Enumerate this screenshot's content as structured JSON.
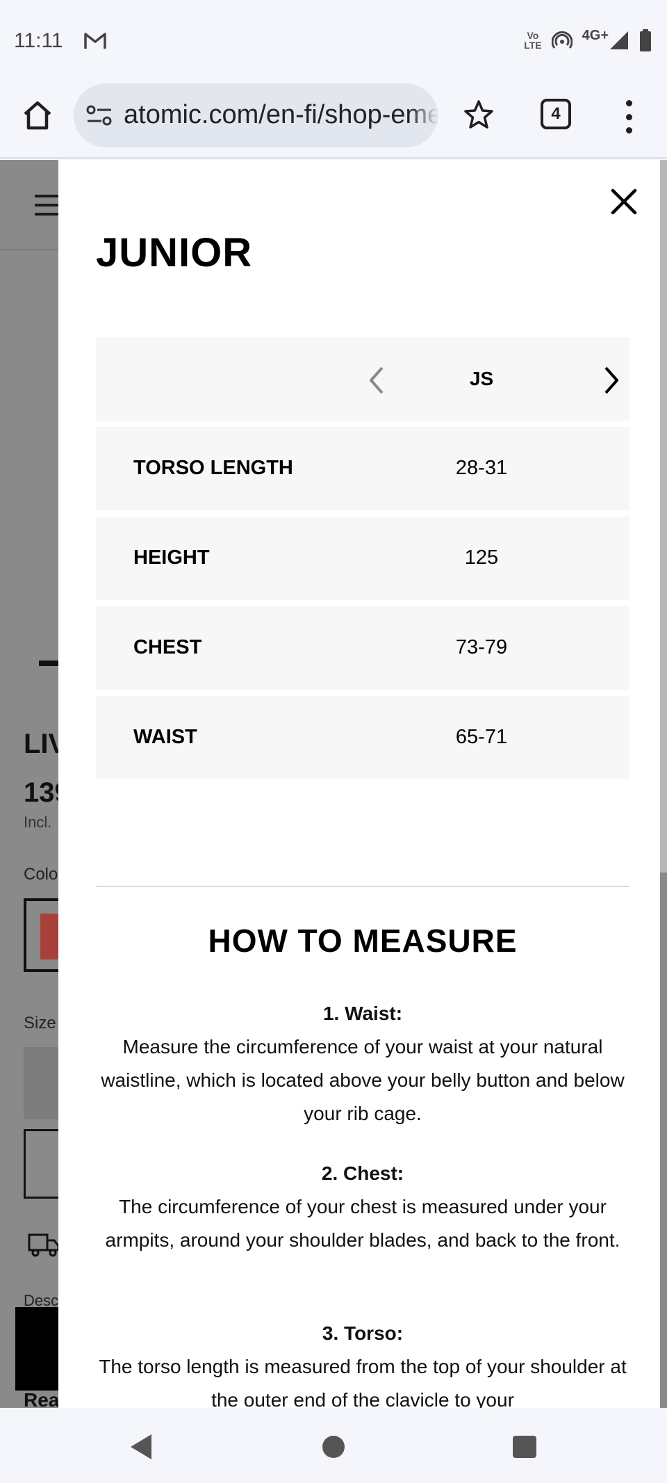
{
  "status_bar": {
    "time": "11:11",
    "network": "4G+",
    "volte_line1": "Vo",
    "volte_line2": "LTE",
    "icons": [
      "gmail-icon",
      "hotspot-icon",
      "signal-icon",
      "battery-icon"
    ]
  },
  "browser": {
    "url": "atomic.com/en-fi/shop-eme",
    "tab_count": "4",
    "icons": [
      "home-icon",
      "tune-icon",
      "star-icon",
      "tabs-icon",
      "more-vert-icon"
    ]
  },
  "background_page": {
    "title_fragment": "LIV",
    "price_fragment": "139",
    "incl_fragment": "Incl.",
    "color_label_fragment": "Colo",
    "size_label_fragment": "Size",
    "description_fragment": "Desc",
    "read_more_fragment": "Rea"
  },
  "modal": {
    "title": "JUNIOR",
    "size_column": "JS",
    "rows": [
      {
        "label": "TORSO LENGTH",
        "value": "28-31"
      },
      {
        "label": "HEIGHT",
        "value": "125"
      },
      {
        "label": "CHEST",
        "value": "73-79"
      },
      {
        "label": "WAIST",
        "value": "65-71"
      }
    ],
    "how_to_measure": {
      "title": "HOW TO MEASURE",
      "steps": [
        {
          "heading": "1. Waist:",
          "text": "Measure the circumference of your waist at your natural waistline, which is located above your belly button and below your rib cage."
        },
        {
          "heading": "2. Chest:",
          "text": "The circumference of your chest is measured under your armpits, around your shoulder blades, and back to the front."
        },
        {
          "heading": "3. Torso:",
          "text": "The torso length is measured from the top of your shoulder at the outer end of the clavicle to your"
        }
      ]
    }
  },
  "colors": {
    "overlay": "#8a8a8a",
    "table_row_bg": "#f7f7f7",
    "swatch": "#a8413a"
  }
}
